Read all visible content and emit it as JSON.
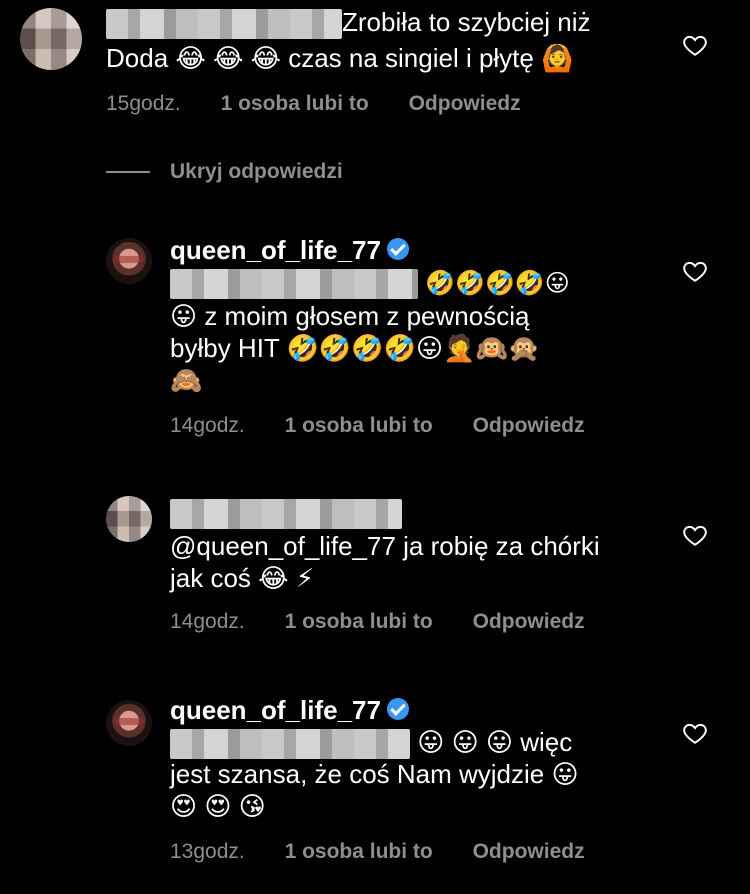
{
  "comments": [
    {
      "line1_text": "Zrobiła to szybciej niż",
      "line2_text": "Doda 😂 😂 😂  czas na singiel i płytę 🙆",
      "time": "15godz.",
      "likes": "1 osoba lubi to",
      "reply": "Odpowiedz"
    },
    {
      "username": "queen_of_life_77",
      "line1_emoji": "🤣🤣🤣🤣😛",
      "line2_text": "😛 z moim głosem z pewnością",
      "line3_text": "byłby HIT 🤣🤣🤣🤣😛🤦🙉🙊",
      "line4_text": "🙈",
      "time": "14godz.",
      "likes": "1 osoba lubi to",
      "reply": "Odpowiedz"
    },
    {
      "line1_text": "@queen_of_life_77 ja robię za chórki",
      "line2_text": "jak coś 😂 ⚡",
      "time": "14godz.",
      "likes": "1 osoba lubi to",
      "reply": "Odpowiedz"
    },
    {
      "username": "queen_of_life_77",
      "line1_text": "😛 😛 😛 więc",
      "line2_text": "jest szansa, że coś Nam wyjdzie 😛",
      "line3_text": "😍 😍 😘",
      "time": "13godz.",
      "likes": "1 osoba lubi to",
      "reply": "Odpowiedz"
    }
  ],
  "hide_replies": "Ukryj odpowiedzi",
  "colors": {
    "background": "#000000",
    "text": "#ffffff",
    "meta": "#8e8e8e",
    "verified": "#3897f0"
  },
  "icons": {
    "like": "heart-outline-icon",
    "verified": "verified-badge-icon"
  }
}
